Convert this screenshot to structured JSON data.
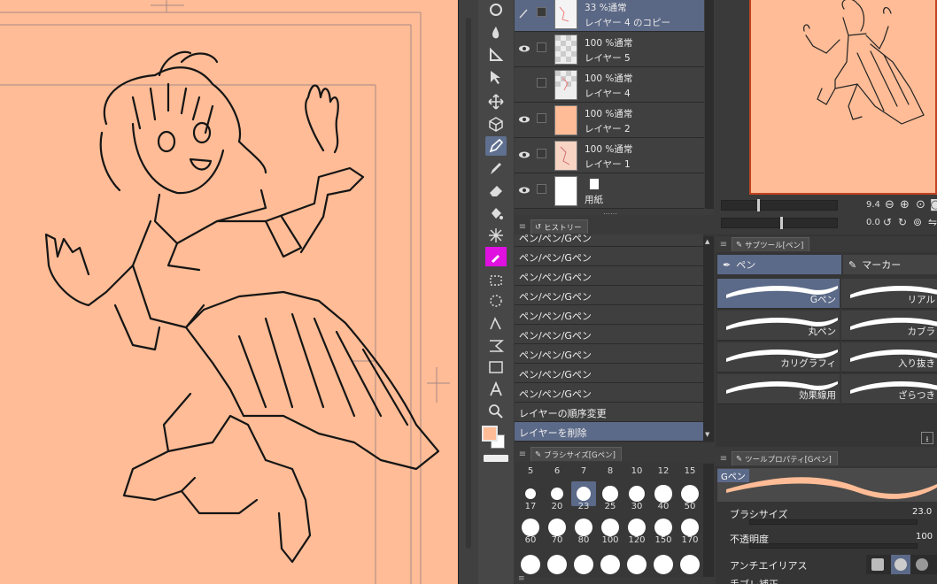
{
  "layers": [
    {
      "line1": "33 %通常",
      "line2": "レイヤー 4 のコピー",
      "selected": true,
      "visible": false
    },
    {
      "line1": "100 %通常",
      "line2": "レイヤー 5",
      "selected": false,
      "visible": true
    },
    {
      "line1": "100 %通常",
      "line2": "レイヤー 4",
      "selected": false,
      "visible": false
    },
    {
      "line1": "100 %通常",
      "line2": "レイヤー 2",
      "selected": false,
      "visible": true
    },
    {
      "line1": "100 %通常",
      "line2": "レイヤー 1",
      "selected": false,
      "visible": true
    },
    {
      "line1": "",
      "line2": "用紙",
      "selected": false,
      "visible": true
    }
  ],
  "history": {
    "tab": "ヒストリー",
    "items": [
      "ペン/ペン/Gペン",
      "ペン/ペン/Gペン",
      "ペン/ペン/Gペン",
      "ペン/ペン/Gペン",
      "ペン/ペン/Gペン",
      "ペン/ペン/Gペン",
      "ペン/ペン/Gペン",
      "ペン/ペン/Gペン",
      "ペン/ペン/Gペン",
      "レイヤーの順序変更",
      "レイヤーを削除"
    ],
    "selected_index": 10
  },
  "brush_size": {
    "tab": "ブラシサイズ[Gペン]",
    "top_row": [
      "5",
      "6",
      "7",
      "8",
      "10",
      "12",
      "15"
    ],
    "rows": [
      [
        "17",
        "20",
        "23",
        "25",
        "30",
        "40",
        "50"
      ],
      [
        "60",
        "70",
        "80",
        "100",
        "120",
        "150",
        "170"
      ]
    ],
    "selected": "23"
  },
  "navigator": {
    "zoom": "9.4",
    "rotation": "0.0"
  },
  "subtool": {
    "tab": "サブツール[ペン]",
    "groups": [
      "ペン",
      "マーカー"
    ],
    "brushes": [
      "Gペン",
      "リアル",
      "丸ペン",
      "カブラ",
      "カリグラフィ",
      "入り抜き",
      "効果線用",
      "ざらつき"
    ],
    "selected": "Gペン"
  },
  "tool_property": {
    "tab": "ツールプロパティ[Gペン]",
    "preview_label": "Gペン",
    "brush_size_label": "ブラシサイズ",
    "brush_size_value": "23.0",
    "opacity_label": "不透明度",
    "opacity_value": "100",
    "antialias_label": "アンチエイリアス",
    "stabilization_label": "手ブレ補正"
  },
  "colors": {
    "canvas": "#ffbc96",
    "selection": "#5c6a89",
    "main_color": "#ffbc96",
    "sub_color": "#ffffff"
  }
}
